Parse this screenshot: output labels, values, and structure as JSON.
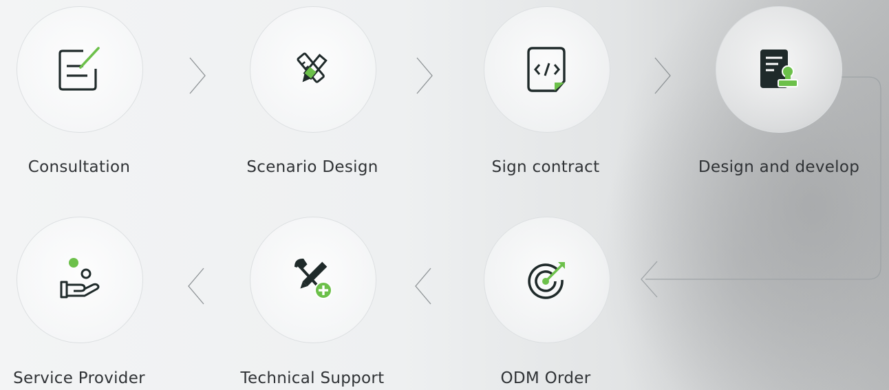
{
  "steps": [
    {
      "id": "consultation",
      "label": "Consultation",
      "icon": "form-pen-icon"
    },
    {
      "id": "scenario-design",
      "label": "Scenario Design",
      "icon": "design-tools-icon"
    },
    {
      "id": "sign-contract",
      "label": "Sign contract",
      "icon": "code-document-icon"
    },
    {
      "id": "design-develop",
      "label": "Design and develop",
      "icon": "document-stamp-icon"
    },
    {
      "id": "odm-order",
      "label": "ODM Order",
      "icon": "target-arrow-icon"
    },
    {
      "id": "technical-support",
      "label": "Technical Support",
      "icon": "tools-plus-icon"
    },
    {
      "id": "service-provider",
      "label": "Service Provider",
      "icon": "hand-coins-icon"
    }
  ],
  "colors": {
    "accent": "#6cc04a",
    "icon_dark": "#1f2a2a",
    "line": "#9ea3a6"
  }
}
